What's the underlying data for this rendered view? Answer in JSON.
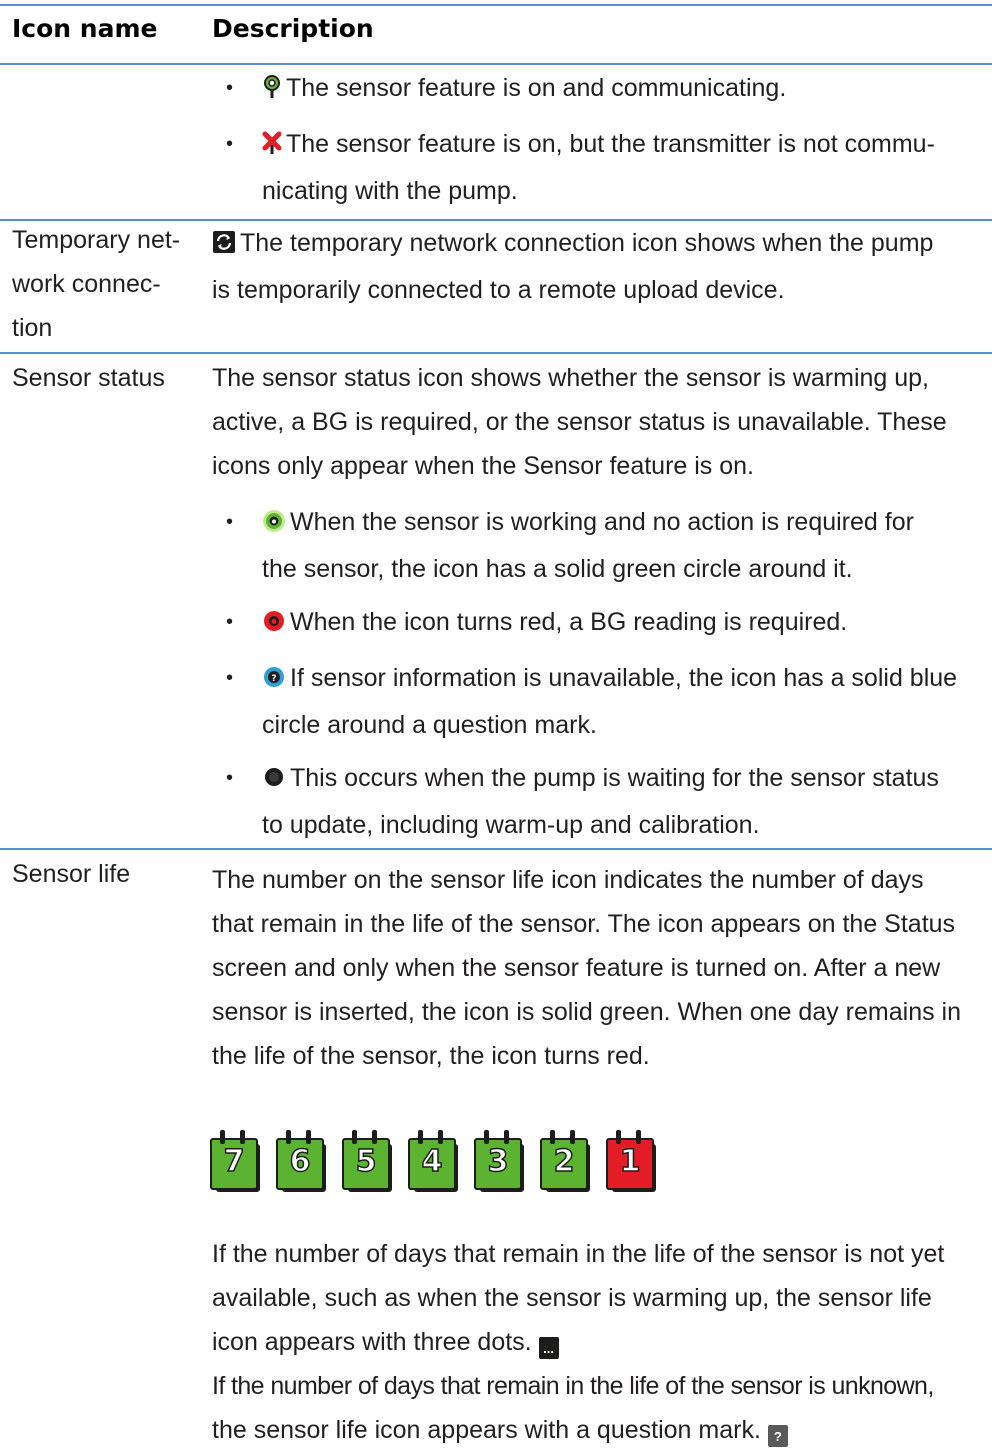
{
  "header": {
    "col_name": "Icon name",
    "col_desc": "Description"
  },
  "rows": {
    "sensor_feature": {
      "bullets": [
        "The sensor feature is on and communicating.",
        "The sensor feature is on, but the transmitter is not commu-",
        "nicating with the pump."
      ]
    },
    "temp_network": {
      "name_lines": [
        "Temporary net-",
        "work connec-",
        "tion"
      ],
      "desc_lines": [
        "The temporary network connection icon shows when the pump",
        "is temporarily connected to a remote upload device."
      ]
    },
    "sensor_status": {
      "name": "Sensor status",
      "desc_lines": [
        "The sensor status icon shows whether the sensor is warming up,",
        "active, a BG is required, or the sensor status is unavailable. These",
        "icons only appear when the Sensor feature is on."
      ],
      "bullets": [
        [
          "When the sensor is working and no action is required for",
          "the sensor, the icon has a solid green circle around it."
        ],
        [
          "When the icon turns red, a BG reading is required."
        ],
        [
          "If sensor information is unavailable, the icon has a solid blue",
          "circle around a question mark."
        ],
        [
          "This occurs when the pump is waiting for the sensor status",
          "to update, including warm-up and calibration."
        ]
      ]
    },
    "sensor_life": {
      "name": "Sensor life",
      "desc_lines": [
        "The number on the sensor life icon indicates the number of days",
        "that remain in the life of the sensor. The icon appears on the Status",
        "screen and only when the sensor feature is turned on. After a new",
        "sensor is inserted, the icon is solid green. When one day remains in",
        "the life of the sensor, the icon turns red."
      ],
      "day_icons": [
        "7",
        "6",
        "5",
        "4",
        "3",
        "2",
        "1"
      ],
      "more_lines": [
        "If the number of days that remain in the life of the sensor is not yet",
        "available, such as when the sensor is warming up, the sensor life",
        "icon appears with three dots.",
        "If the number of days that remain in the life of the sensor is unknown,",
        "the sensor life icon appears with a question mark."
      ],
      "dots_icon": "...",
      "question_icon": "?"
    }
  },
  "colors": {
    "rule": "#5b8ccf",
    "green": "#5cb331",
    "red": "#e31d25"
  }
}
